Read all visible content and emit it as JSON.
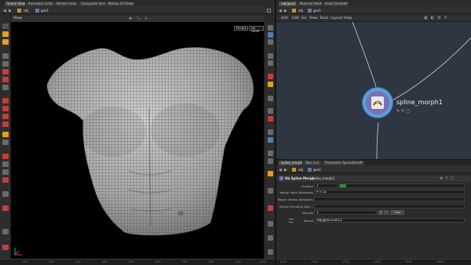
{
  "left_tabs": [
    "Scene View",
    "Animation Editor",
    "Render View",
    "Composite View",
    "Motion FX View"
  ],
  "right_tabs": [
    "/obj/geo1",
    "Material Palette",
    "Asset Browser"
  ],
  "left_path": {
    "root": "obj",
    "node": "geo1"
  },
  "right_path": {
    "root": "obj",
    "node": "geo1"
  },
  "viewport": {
    "title": "View",
    "persp": "Persp▾",
    "camera": "No cam▾"
  },
  "network_menu": [
    "Add",
    "Edit",
    "Go",
    "View",
    "Tools",
    "Layout",
    "Help"
  ],
  "node": {
    "label": "spline_morph1"
  },
  "param_tabs": [
    "spline_morph1",
    "Take List",
    "Parameter Spreadsheet"
  ],
  "param_path": {
    "root": "obj",
    "node": "geo1"
  },
  "params": {
    "header_type": "Hb Spline Morph",
    "header_name": "spline_morph1",
    "position_label": "Position",
    "position_value": "1",
    "position_fraction": 1.0,
    "point_attr_label": "Morph Point Attributes",
    "point_attr_value": "P v Cd",
    "vertex_attr_label": "Morph Vertex Attributes",
    "prim_attr_label": "Morph Primitive Attri...",
    "morphs_label": "Morphs",
    "morphs_value": "1",
    "clear_label": "Clear",
    "morph_label": "Morph",
    "morph_value": "/obj/geo1/null13"
  },
  "ruler_left": [
    "100",
    "200",
    "300",
    "400",
    "500",
    "600",
    "700",
    "800",
    "900",
    "1000"
  ],
  "ruler_right": [
    "1100",
    "1200",
    "1300",
    "1400",
    "1500",
    "1600"
  ],
  "colors": {
    "accent": "#f0a820",
    "slider": "#2f8f2f",
    "node_ring": "#5aa0d8",
    "viewport_bg": "#000000"
  }
}
